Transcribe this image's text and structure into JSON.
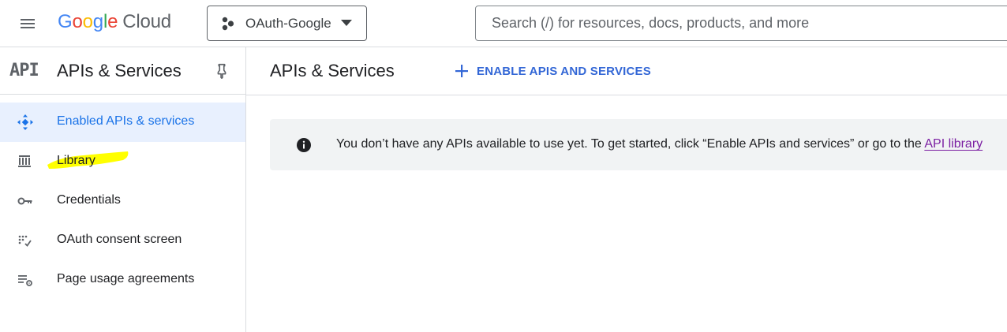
{
  "topbar": {
    "logo": {
      "letters": [
        "G",
        "o",
        "o",
        "g",
        "l",
        "e"
      ],
      "product": "Cloud"
    },
    "project": {
      "name": "OAuth-Google",
      "icon": "project-icon"
    },
    "search": {
      "placeholder": "Search (/) for resources, docs, products, and more"
    },
    "menu_icon": "hamburger-menu-icon"
  },
  "sidebar": {
    "logo_text": "API",
    "title": "APIs & Services",
    "pin_icon": "pin-icon",
    "items": [
      {
        "label": "Enabled APIs & services",
        "icon": "enabled-apis-icon",
        "active": true
      },
      {
        "label": "Library",
        "icon": "library-icon",
        "active": false
      },
      {
        "label": "Credentials",
        "icon": "key-icon",
        "active": false
      },
      {
        "label": "OAuth consent screen",
        "icon": "consent-icon",
        "active": false
      },
      {
        "label": "Page usage agreements",
        "icon": "settings-list-icon",
        "active": false
      }
    ]
  },
  "main": {
    "title": "APIs & Services",
    "enable_button": "ENABLE APIS AND SERVICES",
    "banner": {
      "text": "You don’t have any APIs available to use yet. To get started, click “Enable APIs and services” or go to the ",
      "link": "API library"
    }
  },
  "colors": {
    "accent": "#1a73e8",
    "button_text": "#3367d6",
    "link": "#7b1fa2",
    "active_bg": "#e8f0fe",
    "banner_bg": "#f1f3f4",
    "highlight": "#ffff00"
  }
}
